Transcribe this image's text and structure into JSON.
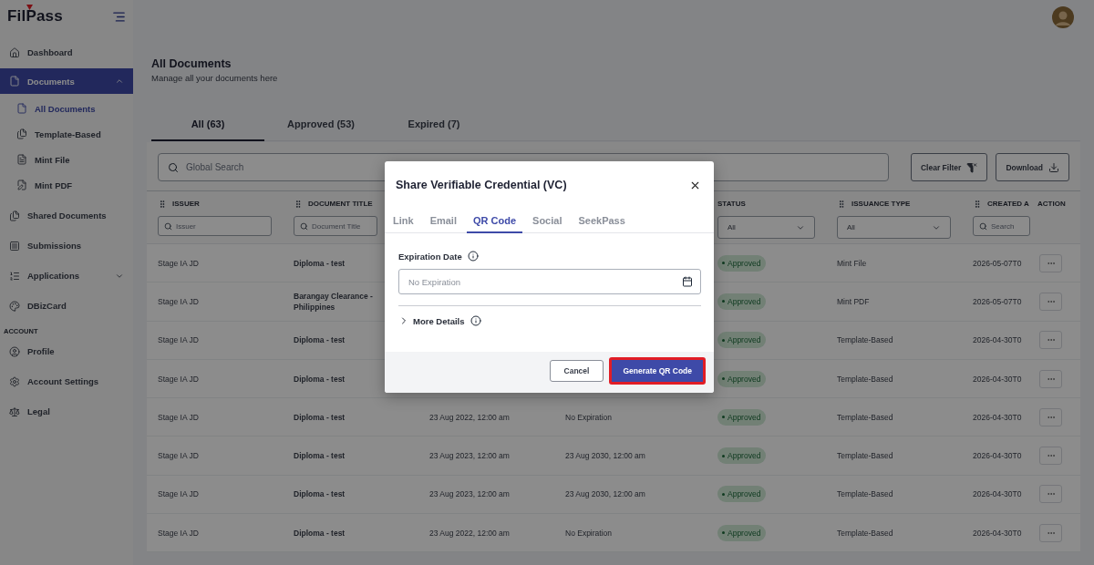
{
  "sidebar": {
    "logo": "FilPass",
    "groups": [
      {
        "items": [
          {
            "label": "Dashboard",
            "selected": false
          },
          {
            "label": "Documents",
            "selected": true,
            "expanded": true,
            "children": [
              {
                "label": "All Documents",
                "selected": true
              },
              {
                "label": "Template-Based",
                "selected": false
              },
              {
                "label": "Mint File",
                "selected": false
              },
              {
                "label": "Mint PDF",
                "selected": false
              }
            ]
          },
          {
            "label": "Shared Documents",
            "selected": false
          },
          {
            "label": "Submissions",
            "selected": false
          },
          {
            "label": "Applications",
            "selected": false,
            "expanded": false
          },
          {
            "label": "DBizCard",
            "selected": false
          }
        ]
      },
      {
        "title": "ACCOUNT",
        "items": [
          {
            "label": "Profile",
            "selected": false
          },
          {
            "label": "Account Settings",
            "selected": false
          },
          {
            "label": "Legal",
            "selected": false
          }
        ]
      }
    ]
  },
  "page": {
    "title": "All Documents",
    "subtitle": "Manage all your documents here"
  },
  "tabs": [
    {
      "label": "All (63)",
      "selected": true
    },
    {
      "label": "Approved (53)",
      "selected": false
    },
    {
      "label": "Expired (7)",
      "selected": false
    }
  ],
  "toolbar": {
    "search": {
      "placeholder": "Global Search"
    },
    "buttons": [
      "Clear Filter",
      "Download"
    ]
  },
  "table": {
    "columns": [
      {
        "label": "ISSUER",
        "handle": true
      },
      {
        "label": "DOCUMENT TITLE",
        "handle": true
      },
      {
        "label": "STATUS",
        "handle": false
      },
      {
        "label": "ISSUANCE TYPE",
        "handle": true
      },
      {
        "label": "CREATED A",
        "handle": true
      },
      {
        "label": "ACTION",
        "handle": false
      }
    ],
    "filters": [
      {
        "kind": "search",
        "placeholder": "Issuer"
      },
      {
        "kind": "search",
        "placeholder": "Document Title"
      },
      {
        "kind": "select",
        "value": "All"
      },
      {
        "kind": "select",
        "value": "All"
      },
      {
        "kind": "search",
        "placeholder": "Search"
      }
    ],
    "rows": [
      {
        "issuer": "Stage IA JD",
        "document_title": "Diploma - test",
        "status": "Approved",
        "issuance_type": "Mint File",
        "created": "2026-05-07T0"
      },
      {
        "issuer": "Stage IA JD",
        "document_title": "Barangay Clearance - Philippines",
        "status": "Approved",
        "issuance_type": "Mint PDF",
        "created": "2026-05-07T0"
      },
      {
        "issuer": "Stage IA JD",
        "document_title": "Diploma - test",
        "status": "Approved",
        "issuance_type": "Template-Based",
        "created": "2026-04-30T0"
      },
      {
        "issuer": "Stage IA JD",
        "document_title": "Diploma - test",
        "status": "Approved",
        "issuance_type": "Template-Based",
        "created": "2026-04-30T0"
      },
      {
        "issuer": "Stage IA JD",
        "document_title": "Diploma - test",
        "column_3": "23 Aug 2022, 12:00 am",
        "column_4": "No Expiration",
        "status": "Approved",
        "issuance_type": "Template-Based",
        "created": "2026-04-30T0"
      },
      {
        "issuer": "Stage IA JD",
        "document_title": "Diploma - test",
        "column_3": "23 Aug 2023, 12:00 am",
        "column_4": "23 Aug 2030, 12:00 am",
        "status": "Approved",
        "issuance_type": "Template-Based",
        "created": "2026-04-30T0"
      },
      {
        "issuer": "Stage IA JD",
        "document_title": "Diploma - test",
        "column_3": "23 Aug 2023, 12:00 am",
        "column_4": "23 Aug 2030, 12:00 am",
        "status": "Approved",
        "issuance_type": "Template-Based",
        "created": "2026-04-30T0"
      },
      {
        "issuer": "Stage IA JD",
        "document_title": "Diploma - test",
        "column_3": "23 Aug 2022, 12:00 am",
        "column_4": "No Expiration",
        "status": "Approved",
        "issuance_type": "Template-Based",
        "created": "2026-04-30T0"
      }
    ]
  },
  "dialog": {
    "title": "Share Verifiable Credential (VC)",
    "tabs": [
      {
        "label": "Link",
        "selected": false
      },
      {
        "label": "Email",
        "selected": false
      },
      {
        "label": "QR Code",
        "selected": true
      },
      {
        "label": "Social",
        "selected": false
      },
      {
        "label": "SeekPass",
        "selected": false
      }
    ],
    "expiration": {
      "label": "Expiration Date",
      "placeholder": "No Expiration"
    },
    "more_details": {
      "label": "More Details",
      "expanded": false
    },
    "buttons": [
      {
        "label": "Cancel",
        "kind": "secondary",
        "highlighted": false
      },
      {
        "label": "Generate QR Code",
        "kind": "primary",
        "highlighted": true
      }
    ]
  }
}
